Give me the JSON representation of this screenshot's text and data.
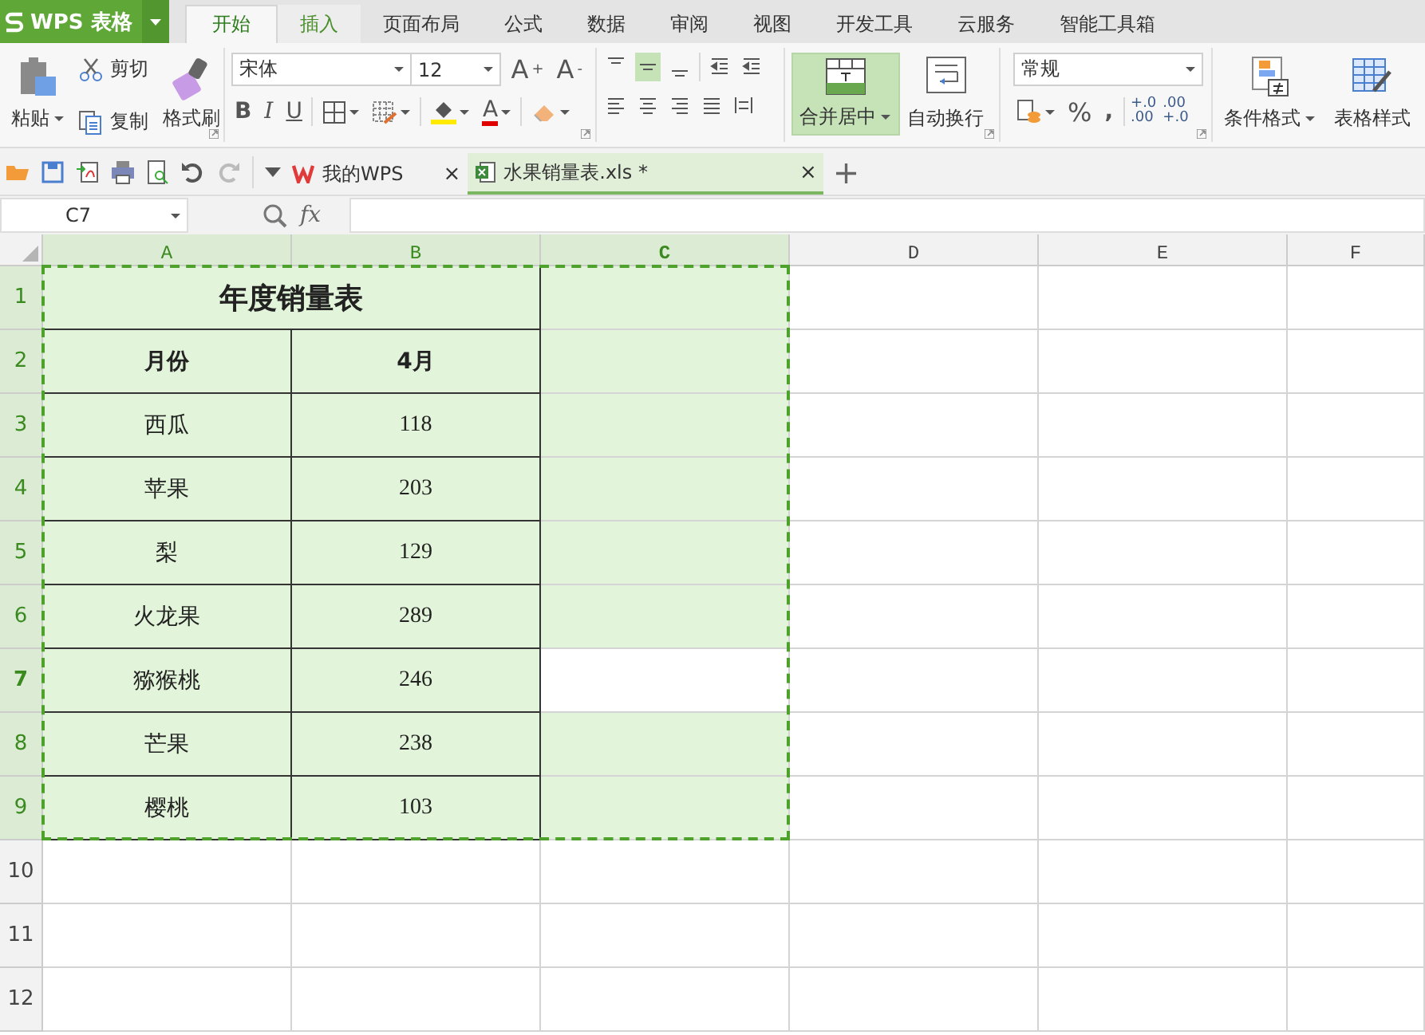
{
  "app": {
    "logo": "WPS 表格"
  },
  "tabs": [
    {
      "label": "开始",
      "selected": true,
      "hovered": false
    },
    {
      "label": "插入",
      "selected": false,
      "hovered": true
    },
    {
      "label": "页面布局",
      "selected": false,
      "hovered": false
    },
    {
      "label": "公式",
      "selected": false,
      "hovered": false
    },
    {
      "label": "数据",
      "selected": false,
      "hovered": false
    },
    {
      "label": "审阅",
      "selected": false,
      "hovered": false
    },
    {
      "label": "视图",
      "selected": false,
      "hovered": false
    },
    {
      "label": "开发工具",
      "selected": false,
      "hovered": false
    },
    {
      "label": "云服务",
      "selected": false,
      "hovered": false
    },
    {
      "label": "智能工具箱",
      "selected": false,
      "hovered": false
    }
  ],
  "ribbon": {
    "paste": "粘贴",
    "cut": "剪切",
    "copy": "复制",
    "format_painter": "格式刷",
    "font_name": "宋体",
    "font_size": "12",
    "grow_font": "A$^{+}$",
    "shrink_font": "A$^{-}$",
    "bold": "B",
    "italic": "I",
    "underline": "U",
    "font_color": "A",
    "vertical_align": [
      {
        "selected": false
      },
      {
        "selected": true
      },
      {
        "selected": false
      }
    ],
    "merge": {
      "label": "合并居中",
      "selected": true
    },
    "wrap": {
      "label": "自动换行",
      "selected": false
    },
    "number_format": "常规",
    "percent": "%",
    "comma": ",",
    "decimals": [
      {
        "top": "+.0",
        "bottom": ".00"
      },
      {
        "top": ".00",
        "bottom": "+.0"
      }
    ],
    "conditional_format": "条件格式",
    "table_style": "表格样式"
  },
  "doc_tabs": [
    {
      "label": "我的WPS",
      "selected": false,
      "close": "×"
    },
    {
      "label": "水果销量表.xls *",
      "selected": true,
      "close": "×"
    }
  ],
  "new_tab": "+",
  "formula_bar": {
    "name_box": "C7",
    "fx": "fx"
  },
  "sheet": {
    "columns": [
      {
        "label": "A",
        "selected": true,
        "active": false
      },
      {
        "label": "B",
        "selected": true,
        "active": false
      },
      {
        "label": "C",
        "selected": true,
        "active": true
      },
      {
        "label": "D",
        "selected": false,
        "active": false
      },
      {
        "label": "E",
        "selected": false,
        "active": false
      },
      {
        "label": "F",
        "selected": false,
        "active": false
      }
    ],
    "rows": [
      {
        "label": "1",
        "selected": true,
        "active": false,
        "kind": "title",
        "cells": [
          "年度销量表"
        ]
      },
      {
        "label": "2",
        "selected": true,
        "active": false,
        "kind": "header",
        "cells": [
          "月份",
          "4月"
        ]
      },
      {
        "label": "3",
        "selected": true,
        "active": false,
        "kind": "data",
        "cells": [
          "西瓜",
          "118"
        ]
      },
      {
        "label": "4",
        "selected": true,
        "active": false,
        "kind": "data",
        "cells": [
          "苹果",
          "203"
        ]
      },
      {
        "label": "5",
        "selected": true,
        "active": false,
        "kind": "data",
        "cells": [
          "梨",
          "129"
        ]
      },
      {
        "label": "6",
        "selected": true,
        "active": false,
        "kind": "data",
        "cells": [
          "火龙果",
          "289"
        ]
      },
      {
        "label": "7",
        "selected": true,
        "active": true,
        "kind": "data",
        "cells": [
          "猕猴桃",
          "246"
        ]
      },
      {
        "label": "8",
        "selected": true,
        "active": false,
        "kind": "data",
        "cells": [
          "芒果",
          "238"
        ]
      },
      {
        "label": "9",
        "selected": true,
        "active": false,
        "kind": "data",
        "cells": [
          "樱桃",
          "103"
        ]
      },
      {
        "label": "10",
        "selected": false,
        "active": false,
        "kind": "empty",
        "cells": []
      },
      {
        "label": "11",
        "selected": false,
        "active": false,
        "kind": "empty",
        "cells": []
      },
      {
        "label": "12",
        "selected": false,
        "active": false,
        "kind": "empty",
        "cells": []
      }
    ]
  }
}
